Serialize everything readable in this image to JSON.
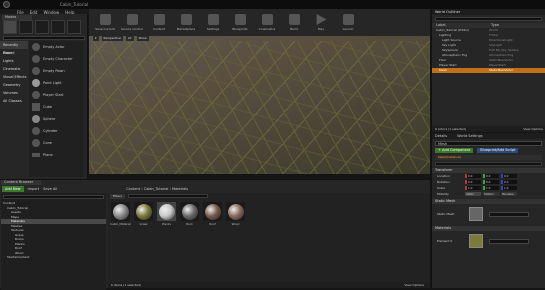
{
  "title": "Cabin_Tutorial",
  "menu": [
    "File",
    "Edit",
    "Window",
    "Help"
  ],
  "modes": {
    "tab": "Modes",
    "categories": [
      "Recently Placed",
      "Basic",
      "Lights",
      "Cinematic",
      "Visual Effects",
      "Geometry",
      "Volumes",
      "All Classes"
    ],
    "items": [
      "Empty Actor",
      "Empty Character",
      "Empty Pawn",
      "Point Light",
      "Player Start",
      "Cube",
      "Sphere",
      "Cylinder",
      "Cone",
      "Plane"
    ]
  },
  "toolbar": [
    "Save Current",
    "Source Control",
    "Content",
    "Marketplace",
    "Settings",
    "Blueprints",
    "Cinematics",
    "Build",
    "Play",
    "Launch"
  ],
  "viewport": {
    "buttons": [
      "Perspective",
      "Lit",
      "Show"
    ]
  },
  "outliner": {
    "tab": "World Outliner",
    "col_label": "Label",
    "col_type": "Type",
    "rows": [
      {
        "label": "Cabin_Tutorial (Editor)",
        "type": "World"
      },
      {
        "label": "Lighting",
        "type": "Folder"
      },
      {
        "label": "Light Source",
        "type": "DirectionalLight"
      },
      {
        "label": "Sky Light",
        "type": "SkyLight"
      },
      {
        "label": "SkySphere",
        "type": "Edit BP_Sky_Sphere"
      },
      {
        "label": "Atmospheric Fog",
        "type": "AtmosphericFog"
      },
      {
        "label": "Floor",
        "type": "StaticMeshActor"
      },
      {
        "label": "Player Start",
        "type": "PlayerStart"
      },
      {
        "label": "Mesh",
        "type": "StaticMeshActor"
      }
    ],
    "footer": "9 actors (1 selected)",
    "view_options": "View Options"
  },
  "details": {
    "tab": "Details",
    "tab2": "World Settings",
    "name": "Mesh",
    "add_component": "+ Add Component",
    "blueprint": "Blueprint/Add Script",
    "instance": "Mesh(Instance)",
    "transform": "Transform",
    "rows": [
      {
        "label": "Location",
        "x": "0.0",
        "y": "0.0",
        "z": "0.0"
      },
      {
        "label": "Rotation",
        "x": "0.0",
        "y": "0.0",
        "z": "0.0"
      },
      {
        "label": "Scale",
        "x": "1.0",
        "y": "1.0",
        "z": "1.0"
      },
      {
        "label": "Mobility",
        "x": "Static",
        "y": "Station",
        "z": "Movable"
      }
    ],
    "static_mesh": "Static Mesh",
    "static_mesh_label": "Static Mesh",
    "materials": "Materials",
    "element": "Element 0"
  },
  "content_browser": {
    "tab": "Content Browser",
    "add_new": "Add New",
    "import": "Import",
    "save_all": "Save All",
    "path": [
      "Content",
      "Cabin_Tutorial",
      "Materials"
    ],
    "tree": [
      "Content",
      "Cabin_Tutorial",
      "Assets",
      "Maps",
      "Materials",
      "Meshes",
      "Textures",
      "Grass",
      "Rocks",
      "Planks",
      "Roof",
      "Wood",
      "StarterContent"
    ],
    "filters": "Filters",
    "assets": [
      {
        "name": "Cabin_Material",
        "color": "#8a8a8a"
      },
      {
        "name": "Grass",
        "color": "#7a7a3a"
      },
      {
        "name": "Planks",
        "color": "#c8c8c8"
      },
      {
        "name": "Rock",
        "color": "#6a6a6a"
      },
      {
        "name": "Roof",
        "color": "#7a5a4a"
      },
      {
        "name": "Wood",
        "color": "#8a6a5a"
      }
    ],
    "footer": "6 items (1 selected)",
    "view_options": "View Options"
  }
}
